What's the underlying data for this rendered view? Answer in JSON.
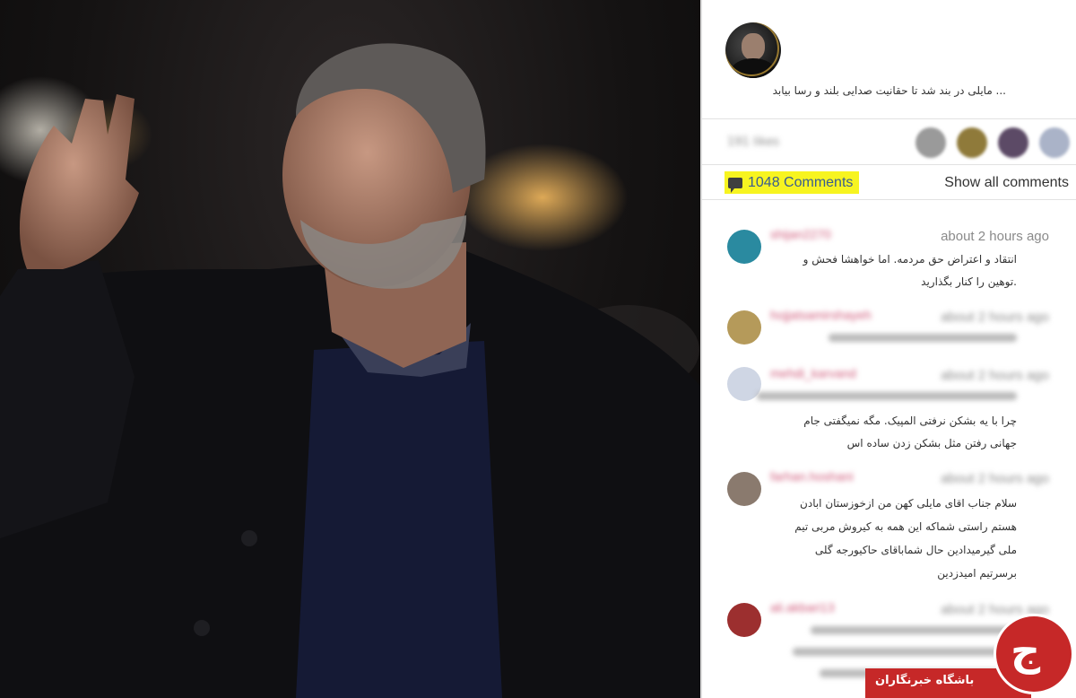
{
  "post": {
    "caption": "... مایلی در بند شد تا حقانیت صدایی بلند و رسا بیابد",
    "likes_blurred": "191 likes"
  },
  "comments_header": {
    "count_label": "1048 Comments",
    "show_all_label": "Show all comments"
  },
  "comments": [
    {
      "username": "shijan2270",
      "time": "about 2 hours ago",
      "lines": [
        "انتقاد و اعتراض حق مردمه. اما خواهشا فحش و",
        ".توهین را کنار بگذارید"
      ],
      "avatar_color": "#2a8aa0"
    },
    {
      "username": "hojjatsamirshayeh",
      "time": "about 2 hours ago",
      "lines": [],
      "avatar_color": "#b59a5a"
    },
    {
      "username": "mehdi_karvand",
      "time": "about 2 hours ago",
      "lines": [
        "چرا با یه بشکن نرفتی المپیک. مگه نمیگفتی جام",
        "جهانی رفتن مثل بشکن زدن ساده اس"
      ],
      "avatar_color": "#cfd6e4"
    },
    {
      "username": "farhan.hoshani",
      "time": "about 2 hours ago",
      "lines": [
        "سلام جناب اقای مایلی کهن من ازخوزستان ابادن",
        "هستم راستی شماکه این همه به کیروش مربی تیم",
        "ملی گیرمیدادین حال شماباقای حاکیورجه گلی",
        "برسرتیم امیدزدین"
      ],
      "avatar_color": "#8a7a6e"
    },
    {
      "username": "ali.akbari13",
      "time": "about 2 hours ago",
      "lines": [],
      "avatar_color": "#9c2f2f"
    }
  ],
  "watermark": {
    "text": "باشگاه خبرنگاران",
    "logo_glyph": "ج"
  },
  "colors": {
    "highlight": "#f7f420",
    "comments_link": "#3a5d8f",
    "username": "#d05a7a",
    "watermark_red": "#c62828"
  }
}
